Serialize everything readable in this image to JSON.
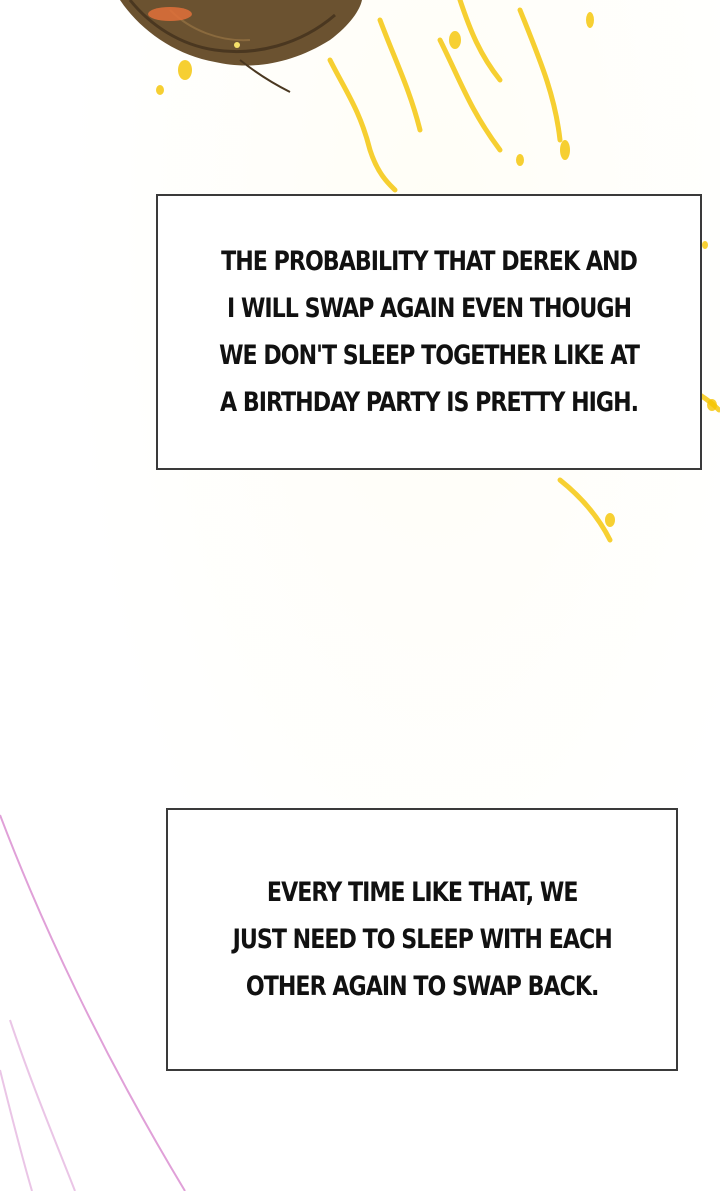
{
  "captions": [
    {
      "text": "THE PROBABILITY THAT DEREK AND\nI WILL SWAP AGAIN EVEN THOUGH\nWE DON'T SLEEP TOGETHER LIKE AT\nA BIRTHDAY PARTY IS PRETTY HIGH."
    },
    {
      "text": "EVERY TIME LIKE THAT, WE\nJUST NEED TO SLEEP WITH EACH\nOTHER AGAIN TO SWAP BACK."
    }
  ],
  "colors": {
    "background": "#ffffff",
    "hair": "#6b5230",
    "sparkle": "#f5c400",
    "accent_line": "#e0a0d8",
    "caption_border": "#3a3a3a"
  },
  "icons": [
    "hair-art",
    "golden-sparkles",
    "pink-lines"
  ]
}
